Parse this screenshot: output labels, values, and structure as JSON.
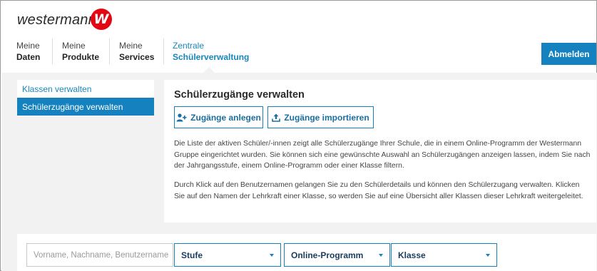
{
  "brand": {
    "name": "westermann",
    "badge_letter": "W",
    "badge_color": "#e30613"
  },
  "nav": {
    "items": [
      {
        "line1": "Meine",
        "line2": "Daten"
      },
      {
        "line1": "Meine",
        "line2": "Produkte"
      },
      {
        "line1": "Meine",
        "line2": "Services"
      },
      {
        "line1": "Zentrale",
        "line2": "Schülerverwaltung"
      }
    ],
    "active_index": 3,
    "logout_label": "Abmelden"
  },
  "sidebar": {
    "items": [
      {
        "label": "Klassen verwalten"
      },
      {
        "label": "Schülerzugänge verwalten"
      }
    ],
    "active_index": 1
  },
  "main": {
    "title": "Schülerzugänge verwalten",
    "add_button_label": "Zugänge anlegen",
    "add_button_icon": "add-user-icon",
    "import_button_label": "Zugänge importieren",
    "import_button_icon": "upload-icon",
    "paragraph1": "Die Liste der aktiven Schüler/-innen zeigt alle Schülerzugänge Ihrer Schule, die in einem Online-Programm der Westermann Gruppe eingerichtet wurden. Sie können sich eine gewünschte Auswahl an Schülerzugängen anzeigen lassen, indem Sie nach der Jahrgangsstufe, einem Online-Programm oder einer Klasse filtern.",
    "paragraph2": "Durch Klick auf den Benutzernamen gelangen Sie zu den Schülerdetails und können den Schülerzugang verwalten. Klicken Sie auf den Namen der Lehrkraft einer Klasse, so werden Sie auf eine Übersicht aller Klassen dieser Lehrkraft weitergeleitet."
  },
  "filters": {
    "search_placeholder": "Vorname, Nachname, Benutzername",
    "search_value": "",
    "stufe_label": "Stufe",
    "programm_label": "Online-Programm",
    "klasse_label": "Klasse"
  },
  "colors": {
    "accent": "#1582bf",
    "link": "#1a86b8",
    "background_gray": "#f2f2f2"
  }
}
